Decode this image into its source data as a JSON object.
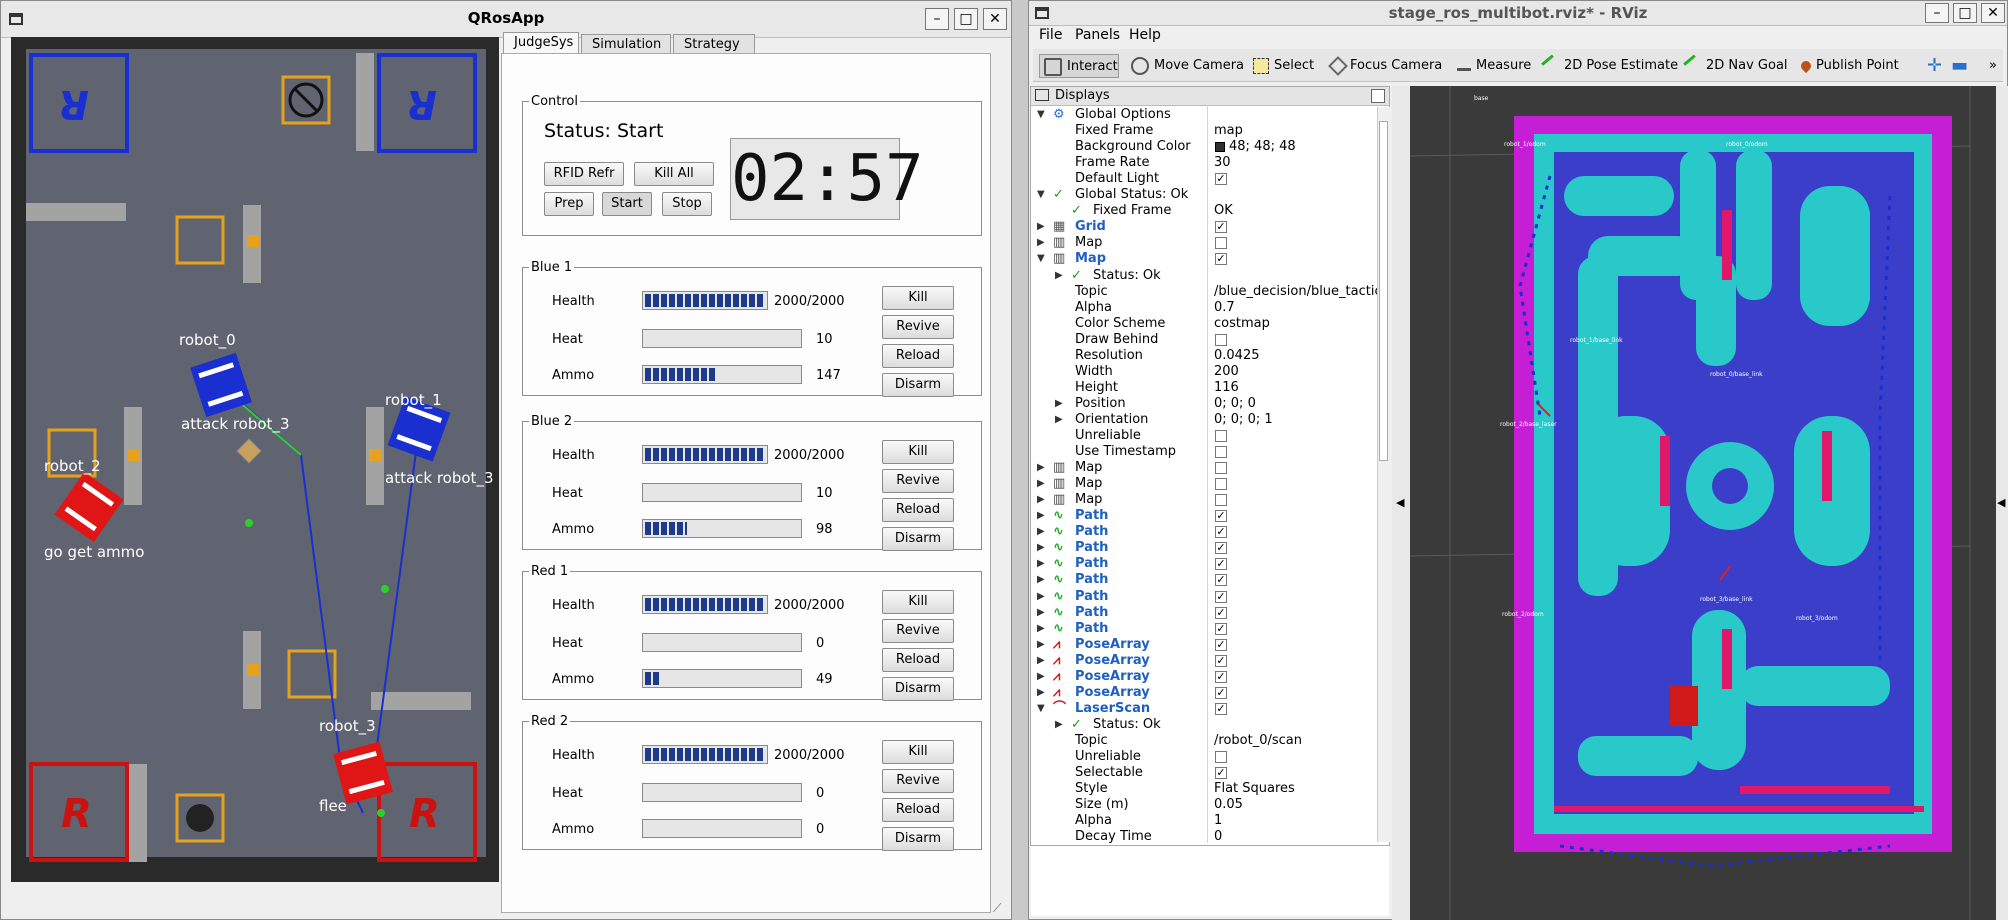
{
  "qros": {
    "title": "QRosApp",
    "buttons": {
      "min": "–",
      "max": "□",
      "close": "✕"
    },
    "tabs": [
      "JudgeSys",
      "Simulation",
      "Strategy"
    ],
    "control": {
      "legend": "Control",
      "status": "Status: Start",
      "timer": "02:57",
      "buttons": [
        "RFID Refr",
        "Kill All",
        "Prep",
        "Start",
        "Stop"
      ]
    },
    "robots": [
      {
        "name": "Blue 1",
        "health_label": "Health",
        "health": "2000/2000",
        "health_frac": 1.0,
        "heat_label": "Heat",
        "heat": "10",
        "heat_frac": 0.0,
        "ammo_label": "Ammo",
        "ammo": "147",
        "ammo_frac": 0.47
      },
      {
        "name": "Blue 2",
        "health_label": "Health",
        "health": "2000/2000",
        "health_frac": 1.0,
        "heat_label": "Heat",
        "heat": "10",
        "heat_frac": 0.0,
        "ammo_label": "Ammo",
        "ammo": "98",
        "ammo_frac": 0.29
      },
      {
        "name": "Red 1",
        "health_label": "Health",
        "health": "2000/2000",
        "health_frac": 1.0,
        "heat_label": "Heat",
        "heat": "0",
        "heat_frac": 0.0,
        "ammo_label": "Ammo",
        "ammo": "49",
        "ammo_frac": 0.12
      },
      {
        "name": "Red 2",
        "health_label": "Health",
        "health": "2000/2000",
        "health_frac": 1.0,
        "heat_label": "Heat",
        "heat": "0",
        "heat_frac": 0.0,
        "ammo_label": "Ammo",
        "ammo": "0",
        "ammo_frac": 0.0
      }
    ],
    "robot_buttons": [
      "Kill",
      "Revive",
      "Reload",
      "Disarm"
    ],
    "field": {
      "labels": {
        "robot_0": "robot_0",
        "robot_1": "robot_1",
        "robot_2": "robot_2",
        "robot_3": "robot_3"
      },
      "behaviors": {
        "robot_0": "attack robot_3",
        "robot_1": "attack robot_3",
        "robot_2": "go get ammo",
        "robot_3": "flee"
      }
    }
  },
  "rviz": {
    "title": "stage_ros_multibot.rviz* - RViz",
    "menu": [
      "File",
      "Panels",
      "Help"
    ],
    "tools": [
      "Interact",
      "Move Camera",
      "Select",
      "Focus Camera",
      "Measure",
      "2D Pose Estimate",
      "2D Nav Goal",
      "Publish Point"
    ],
    "displays_title": "Displays",
    "rows": [
      {
        "label": "Global Options",
        "value": "",
        "icon": "gear-icon",
        "expand": "open",
        "indent": 0
      },
      {
        "label": "Fixed Frame",
        "value": "map",
        "indent": 1
      },
      {
        "label": "Background Color",
        "value": "48; 48; 48",
        "indent": 1,
        "swatch": "#303030"
      },
      {
        "label": "Frame Rate",
        "value": "30",
        "indent": 1
      },
      {
        "label": "Default Light",
        "value": "",
        "indent": 1,
        "check": true
      },
      {
        "label": "Global Status: Ok",
        "value": "",
        "icon": "check-icon",
        "expand": "open",
        "indent": 0
      },
      {
        "label": "Fixed Frame",
        "value": "OK",
        "icon": "check-icon",
        "indent": 1
      },
      {
        "label": "Grid",
        "value": "",
        "icon": "grid-icon",
        "expand": "closed",
        "indent": 0,
        "check": true,
        "blue": true
      },
      {
        "label": "Map",
        "value": "",
        "icon": "map-icon",
        "expand": "closed",
        "indent": 0,
        "check": false
      },
      {
        "label": "Map",
        "value": "",
        "icon": "map-icon",
        "expand": "open",
        "indent": 0,
        "check": true,
        "blue": true
      },
      {
        "label": "Status: Ok",
        "value": "",
        "icon": "check-icon",
        "expand": "closed",
        "indent": 1
      },
      {
        "label": "Topic",
        "value": "/blue_decision/blue_tactic_",
        "indent": 1
      },
      {
        "label": "Alpha",
        "value": "0.7",
        "indent": 1
      },
      {
        "label": "Color Scheme",
        "value": "costmap",
        "indent": 1
      },
      {
        "label": "Draw Behind",
        "value": "",
        "indent": 1,
        "check": false
      },
      {
        "label": "Resolution",
        "value": "0.0425",
        "indent": 1
      },
      {
        "label": "Width",
        "value": "200",
        "indent": 1
      },
      {
        "label": "Height",
        "value": "116",
        "indent": 1
      },
      {
        "label": "Position",
        "value": "0; 0; 0",
        "expand": "closed",
        "indent": 1
      },
      {
        "label": "Orientation",
        "value": "0; 0; 0; 1",
        "expand": "closed",
        "indent": 1
      },
      {
        "label": "Unreliable",
        "value": "",
        "indent": 1,
        "check": false
      },
      {
        "label": "Use Timestamp",
        "value": "",
        "indent": 1,
        "check": false
      },
      {
        "label": "Map",
        "value": "",
        "icon": "map-icon",
        "expand": "closed",
        "indent": 0,
        "check": false
      },
      {
        "label": "Map",
        "value": "",
        "icon": "map-icon",
        "expand": "closed",
        "indent": 0,
        "check": false
      },
      {
        "label": "Map",
        "value": "",
        "icon": "map-icon",
        "expand": "closed",
        "indent": 0,
        "check": false
      },
      {
        "label": "Path",
        "value": "",
        "icon": "path-icon",
        "expand": "closed",
        "indent": 0,
        "check": true,
        "blue": true
      },
      {
        "label": "Path",
        "value": "",
        "icon": "path-icon",
        "expand": "closed",
        "indent": 0,
        "check": true,
        "blue": true
      },
      {
        "label": "Path",
        "value": "",
        "icon": "path-icon",
        "expand": "closed",
        "indent": 0,
        "check": true,
        "blue": true
      },
      {
        "label": "Path",
        "value": "",
        "icon": "path-icon",
        "expand": "closed",
        "indent": 0,
        "check": true,
        "blue": true
      },
      {
        "label": "Path",
        "value": "",
        "icon": "path-icon",
        "expand": "closed",
        "indent": 0,
        "check": true,
        "blue": true
      },
      {
        "label": "Path",
        "value": "",
        "icon": "path-icon",
        "expand": "closed",
        "indent": 0,
        "check": true,
        "blue": true
      },
      {
        "label": "Path",
        "value": "",
        "icon": "path-icon",
        "expand": "closed",
        "indent": 0,
        "check": true,
        "blue": true
      },
      {
        "label": "Path",
        "value": "",
        "icon": "path-icon",
        "expand": "closed",
        "indent": 0,
        "check": true,
        "blue": true
      },
      {
        "label": "PoseArray",
        "value": "",
        "icon": "posearray-icon",
        "expand": "closed",
        "indent": 0,
        "check": true,
        "blue": true
      },
      {
        "label": "PoseArray",
        "value": "",
        "icon": "posearray-icon",
        "expand": "closed",
        "indent": 0,
        "check": true,
        "blue": true
      },
      {
        "label": "PoseArray",
        "value": "",
        "icon": "posearray-icon",
        "expand": "closed",
        "indent": 0,
        "check": true,
        "blue": true
      },
      {
        "label": "PoseArray",
        "value": "",
        "icon": "posearray-icon",
        "expand": "closed",
        "indent": 0,
        "check": true,
        "blue": true
      },
      {
        "label": "LaserScan",
        "value": "",
        "icon": "laserscan-icon",
        "expand": "open",
        "indent": 0,
        "check": true,
        "blue": true
      },
      {
        "label": "Status: Ok",
        "value": "",
        "icon": "check-icon",
        "expand": "closed",
        "indent": 1
      },
      {
        "label": "Topic",
        "value": "/robot_0/scan",
        "indent": 1
      },
      {
        "label": "Unreliable",
        "value": "",
        "indent": 1,
        "check": false
      },
      {
        "label": "Selectable",
        "value": "",
        "indent": 1,
        "check": true
      },
      {
        "label": "Style",
        "value": "Flat Squares",
        "indent": 1
      },
      {
        "label": "Size (m)",
        "value": "0.05",
        "indent": 1
      },
      {
        "label": "Alpha",
        "value": "1",
        "indent": 1
      },
      {
        "label": "Decay Time",
        "value": "0",
        "indent": 1
      }
    ]
  }
}
